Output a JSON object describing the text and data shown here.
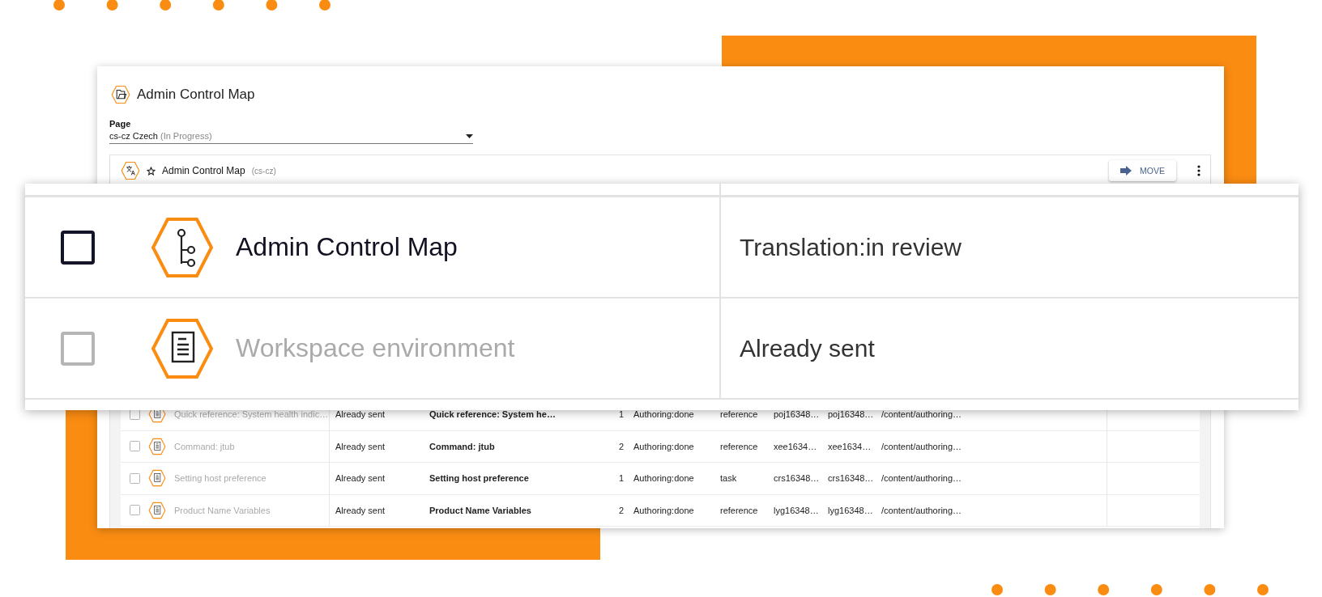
{
  "window": {
    "title": "Admin Control Map"
  },
  "page_field": {
    "label": "Page",
    "value": "cs-cz Czech",
    "status": "(In Progress)"
  },
  "card": {
    "title": "Admin Control Map",
    "locale": "(cs-cz)",
    "move_button": "MOVE"
  },
  "rows": [
    {
      "checked": false,
      "disabled": true,
      "name": "Quick reference: System health indic…",
      "status": "Already sent",
      "title": "Quick reference: System he…",
      "version": "1",
      "state": "Authoring:done",
      "type": "reference",
      "column_7": "poj16348…",
      "column_8": "poj16348…",
      "path": "/content/authoring…"
    },
    {
      "checked": false,
      "disabled": true,
      "name": "Command: jtub",
      "status": "Already sent",
      "title": "Command: jtub",
      "version": "2",
      "state": "Authoring:done",
      "type": "reference",
      "column_7": "xee1634…",
      "column_8": "xee1634…",
      "path": "/content/authoring…"
    },
    {
      "checked": false,
      "disabled": true,
      "name": "Setting host preference",
      "status": "Already sent",
      "title": "Setting host preference",
      "version": "1",
      "state": "Authoring:done",
      "type": "task",
      "column_7": "crs16348…",
      "column_8": "crs16348…",
      "path": "/content/authoring…"
    },
    {
      "checked": false,
      "disabled": true,
      "name": "Product Name Variables",
      "status": "Already sent",
      "title": "Product Name Variables",
      "version": "2",
      "state": "Authoring:done",
      "type": "reference",
      "column_7": "lyg16348…",
      "column_8": "lyg16348…",
      "path": "/content/authoring…"
    }
  ],
  "zoomed_rows": [
    {
      "kind": "map",
      "checked": false,
      "disabled": false,
      "title": "Admin Control Map",
      "status": "Translation:in review"
    },
    {
      "kind": "topic",
      "checked": false,
      "disabled": true,
      "title": "Workspace environment",
      "status": "Already sent"
    }
  ]
}
